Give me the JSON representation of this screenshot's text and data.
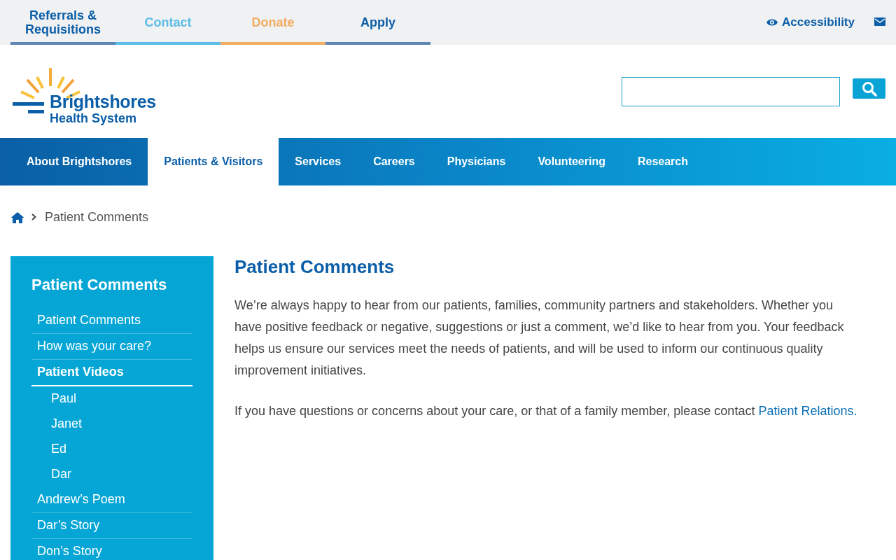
{
  "utility_links": [
    {
      "label": "Referrals & Requisitions",
      "color": "#5b86b5"
    },
    {
      "label": "Contact",
      "color": "#5bbde6"
    },
    {
      "label": "Donate",
      "color": "#f2ad62"
    },
    {
      "label": "Apply",
      "color": "#5b86b5"
    }
  ],
  "accessibility": {
    "label": "Accessibility"
  },
  "logo": {
    "name": "Brightshores",
    "tagline": "Health System"
  },
  "main_nav": [
    {
      "label": "About Brightshores",
      "selected": false
    },
    {
      "label": "Patients & Visitors",
      "selected": true
    },
    {
      "label": "Services",
      "selected": false
    },
    {
      "label": "Careers",
      "selected": false
    },
    {
      "label": "Physicians",
      "selected": false
    },
    {
      "label": "Volunteering",
      "selected": false
    },
    {
      "label": "Research",
      "selected": false
    }
  ],
  "breadcrumb": [
    "Patient Comments"
  ],
  "sidebar": {
    "title": "Patient Comments",
    "items": [
      {
        "label": "Patient Comments",
        "selected": false
      },
      {
        "label": "How was your care?",
        "selected": false
      },
      {
        "label": "Patient Videos",
        "selected": true,
        "children": [
          {
            "label": "Paul"
          },
          {
            "label": "Janet"
          },
          {
            "label": "Ed"
          },
          {
            "label": "Dar"
          }
        ]
      },
      {
        "label": "Andrew’s Poem",
        "selected": false
      },
      {
        "label": "Dar’s Story",
        "selected": false
      },
      {
        "label": "Don’s Story",
        "selected": false
      }
    ]
  },
  "content": {
    "title": "Patient Comments",
    "paragraphs": [
      {
        "text": "We’re always happy to hear from our patients, families, community partners and stakeholders. Whether you have positive feedback or negative, suggestions or just a comment, we’d like to hear from you. Your feedback helps us ensure our services meet the needs of patients, and will be used to inform our continuous quality improvement initiatives."
      },
      {
        "text": "If you have questions or concerns about your care, or that of a family member, please contact ",
        "link": "Patient Relations."
      }
    ]
  }
}
